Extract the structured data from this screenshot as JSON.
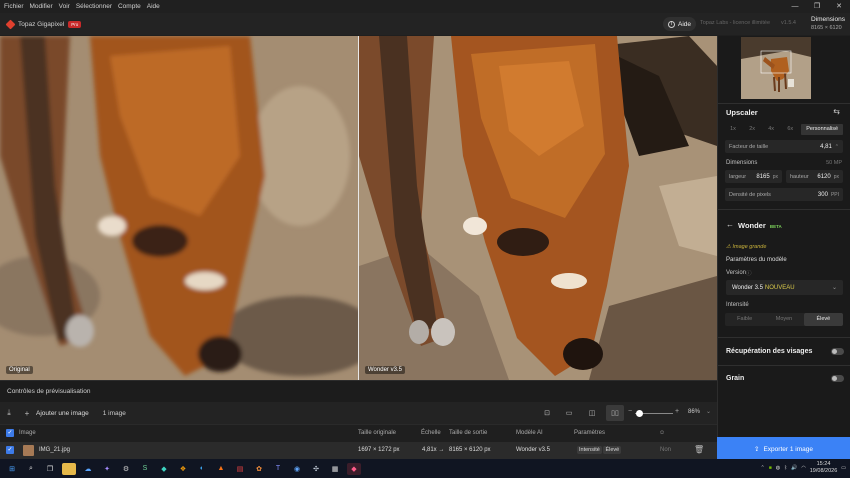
{
  "menu": [
    "Fichier",
    "Modifier",
    "Voir",
    "Sélectionner",
    "Compte",
    "Aide"
  ],
  "window_controls": [
    "—",
    "❐",
    "✕"
  ],
  "header": {
    "app_name": "Topaz Gigapixel",
    "badge": "Pro",
    "help_label": "Aide",
    "license": "Topaz Labs - licence illimitée",
    "version": "v1.5.4",
    "dims_title": "Dimensions",
    "dims_value": "8165 × 6120"
  },
  "preview": {
    "left_label": "Original",
    "right_label": "Wonder v3.5"
  },
  "controls_label": "Contrôles de prévisualisation",
  "toolbar": {
    "add_image": "Ajouter une image",
    "count": "1 image",
    "zoom": "86%"
  },
  "table": {
    "headers": [
      "Image",
      "Taille originale",
      "Échelle",
      "Taille de sortie",
      "Modèle AI",
      "Paramètres"
    ],
    "row": {
      "name": "IMG_21.jpg",
      "original_size": "1697 × 1272 px",
      "scale": "4,81x →",
      "output_size": "8165 × 6120 px",
      "model": "Wonder v3.5",
      "param_label": "Intensité",
      "param_value": "Élevé",
      "extra": "Non"
    }
  },
  "sidebar": {
    "upscaler_title": "Upscaler",
    "scale_options": [
      "1x",
      "2x",
      "4x",
      "6x",
      "Personnalisé"
    ],
    "scale_selected": "Personnalisé",
    "size_factor_label": "Facteur de taille",
    "size_factor_value": "4,81",
    "dimensions_label": "Dimensions",
    "dimensions_mp": "50 MP",
    "width_label": "largeur",
    "width_value": "8165",
    "width_unit": "px",
    "height_label": "hauteur",
    "height_value": "6120",
    "height_unit": "px",
    "density_label": "Densité de pixels",
    "density_value": "300",
    "density_unit": "PPI",
    "model_title": "Wonder",
    "model_badge": "BETA",
    "warning": "Image grande",
    "params_title": "Paramètres du modèle",
    "version_label": "Version",
    "version_value": "Wonder 3.5",
    "version_new": "NOUVEAU",
    "intensity_label": "Intensité",
    "intensity_options": [
      "Faible",
      "Moyen",
      "Élevé"
    ],
    "intensity_selected": "Élevé",
    "face_recovery": "Récupération des visages",
    "grain": "Grain",
    "export": "Exporter 1 image"
  },
  "taskbar": {
    "time": "15:24",
    "date": "19/08/2026"
  },
  "colors": {
    "accent": "#3b82f6",
    "brand": "#e0402e",
    "beta": "#7cd15a",
    "warning": "#c9b23b"
  }
}
